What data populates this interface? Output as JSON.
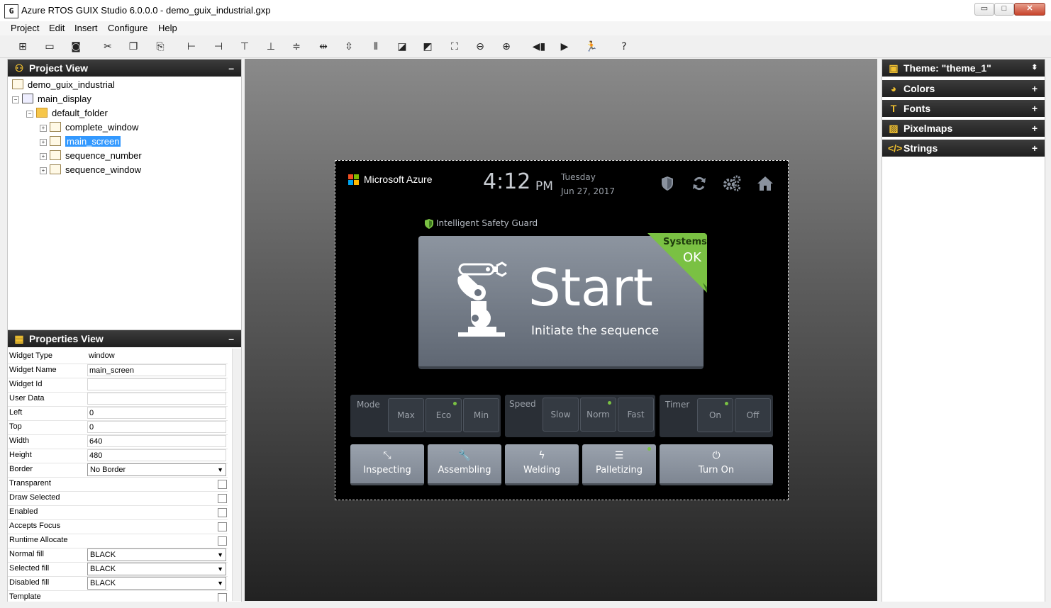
{
  "window": {
    "title": "Azure RTOS GUIX Studio 6.0.0.0 - demo_guix_industrial.gxp",
    "app_icon_text": "G",
    "minimize": "▭",
    "maximize": "□",
    "close": "✕"
  },
  "menu": [
    "Project",
    "Edit",
    "Insert",
    "Configure",
    "Help"
  ],
  "toolbar": [
    "new-icon",
    "open-icon",
    "save-icon",
    "cut-icon",
    "copy-icon",
    "paste-icon",
    "align-left-icon",
    "align-right-icon",
    "align-top-icon",
    "align-bottom-icon",
    "center-horizontal-icon",
    "equal-width-icon",
    "equal-height-icon",
    "center-vertical-icon",
    "move-to-front-icon",
    "move-to-back-icon",
    "fit-content-icon",
    "zoom-out-icon",
    "zoom-in-icon",
    "record-macro-icon",
    "playback-icon",
    "run-icon",
    "help-icon"
  ],
  "project_view": {
    "title": "Project View",
    "collapse": "–",
    "tree": {
      "root": "demo_guix_industrial",
      "display": "main_display",
      "folder": "default_folder",
      "items": [
        "complete_window",
        "main_screen",
        "sequence_number",
        "sequence_window"
      ],
      "selected": "main_screen"
    }
  },
  "properties_view": {
    "title": "Properties View",
    "collapse": "–",
    "rows": [
      {
        "label": "Widget Type",
        "value": "window",
        "kind": "text"
      },
      {
        "label": "Widget Name",
        "value": "main_screen",
        "kind": "input"
      },
      {
        "label": "Widget Id",
        "value": "",
        "kind": "input"
      },
      {
        "label": "User Data",
        "value": "",
        "kind": "input"
      },
      {
        "label": "Left",
        "value": "0",
        "kind": "input"
      },
      {
        "label": "Top",
        "value": "0",
        "kind": "input"
      },
      {
        "label": "Width",
        "value": "640",
        "kind": "input"
      },
      {
        "label": "Height",
        "value": "480",
        "kind": "input"
      },
      {
        "label": "Border",
        "value": "No Border",
        "kind": "select"
      },
      {
        "label": "Transparent",
        "value": "",
        "kind": "check"
      },
      {
        "label": "Draw Selected",
        "value": "",
        "kind": "check"
      },
      {
        "label": "Enabled",
        "value": "",
        "kind": "check"
      },
      {
        "label": "Accepts Focus",
        "value": "",
        "kind": "check"
      },
      {
        "label": "Runtime Allocate",
        "value": "",
        "kind": "check"
      },
      {
        "label": "Normal fill",
        "value": "BLACK",
        "kind": "select"
      },
      {
        "label": "Selected fill",
        "value": "BLACK",
        "kind": "select"
      },
      {
        "label": "Disabled fill",
        "value": "BLACK",
        "kind": "select"
      },
      {
        "label": "Template",
        "value": "",
        "kind": "check"
      }
    ]
  },
  "screen": {
    "brand": "Microsoft Azure",
    "time": "4:12",
    "ampm": "PM",
    "day": "Tuesday",
    "date": "Jun 27, 2017",
    "guard_label": "Intelligent Safety Guard",
    "start_title": "Start",
    "start_sub": "Initiate the sequence",
    "status_line1": "Systems",
    "status_line2": "OK",
    "mode": {
      "label": "Mode",
      "options": [
        "Max",
        "Eco",
        "Min"
      ],
      "active": "Eco"
    },
    "speed": {
      "label": "Speed",
      "options": [
        "Slow",
        "Norm",
        "Fast"
      ],
      "active": "Norm"
    },
    "timer": {
      "label": "Timer",
      "options": [
        "On",
        "Off"
      ],
      "active": "On"
    },
    "tasks": [
      "Inspecting",
      "Assembling",
      "Welding",
      "Palletizing",
      "Turn On"
    ],
    "colors": {
      "accent_green": "#7ac143",
      "panel_gray": "#6b7482",
      "button_gray": "#8a929e"
    }
  },
  "resources": {
    "theme": "Theme: \"theme_1\"",
    "sections": [
      "Colors",
      "Fonts",
      "Pixelmaps",
      "Strings"
    ],
    "expand": "+"
  }
}
